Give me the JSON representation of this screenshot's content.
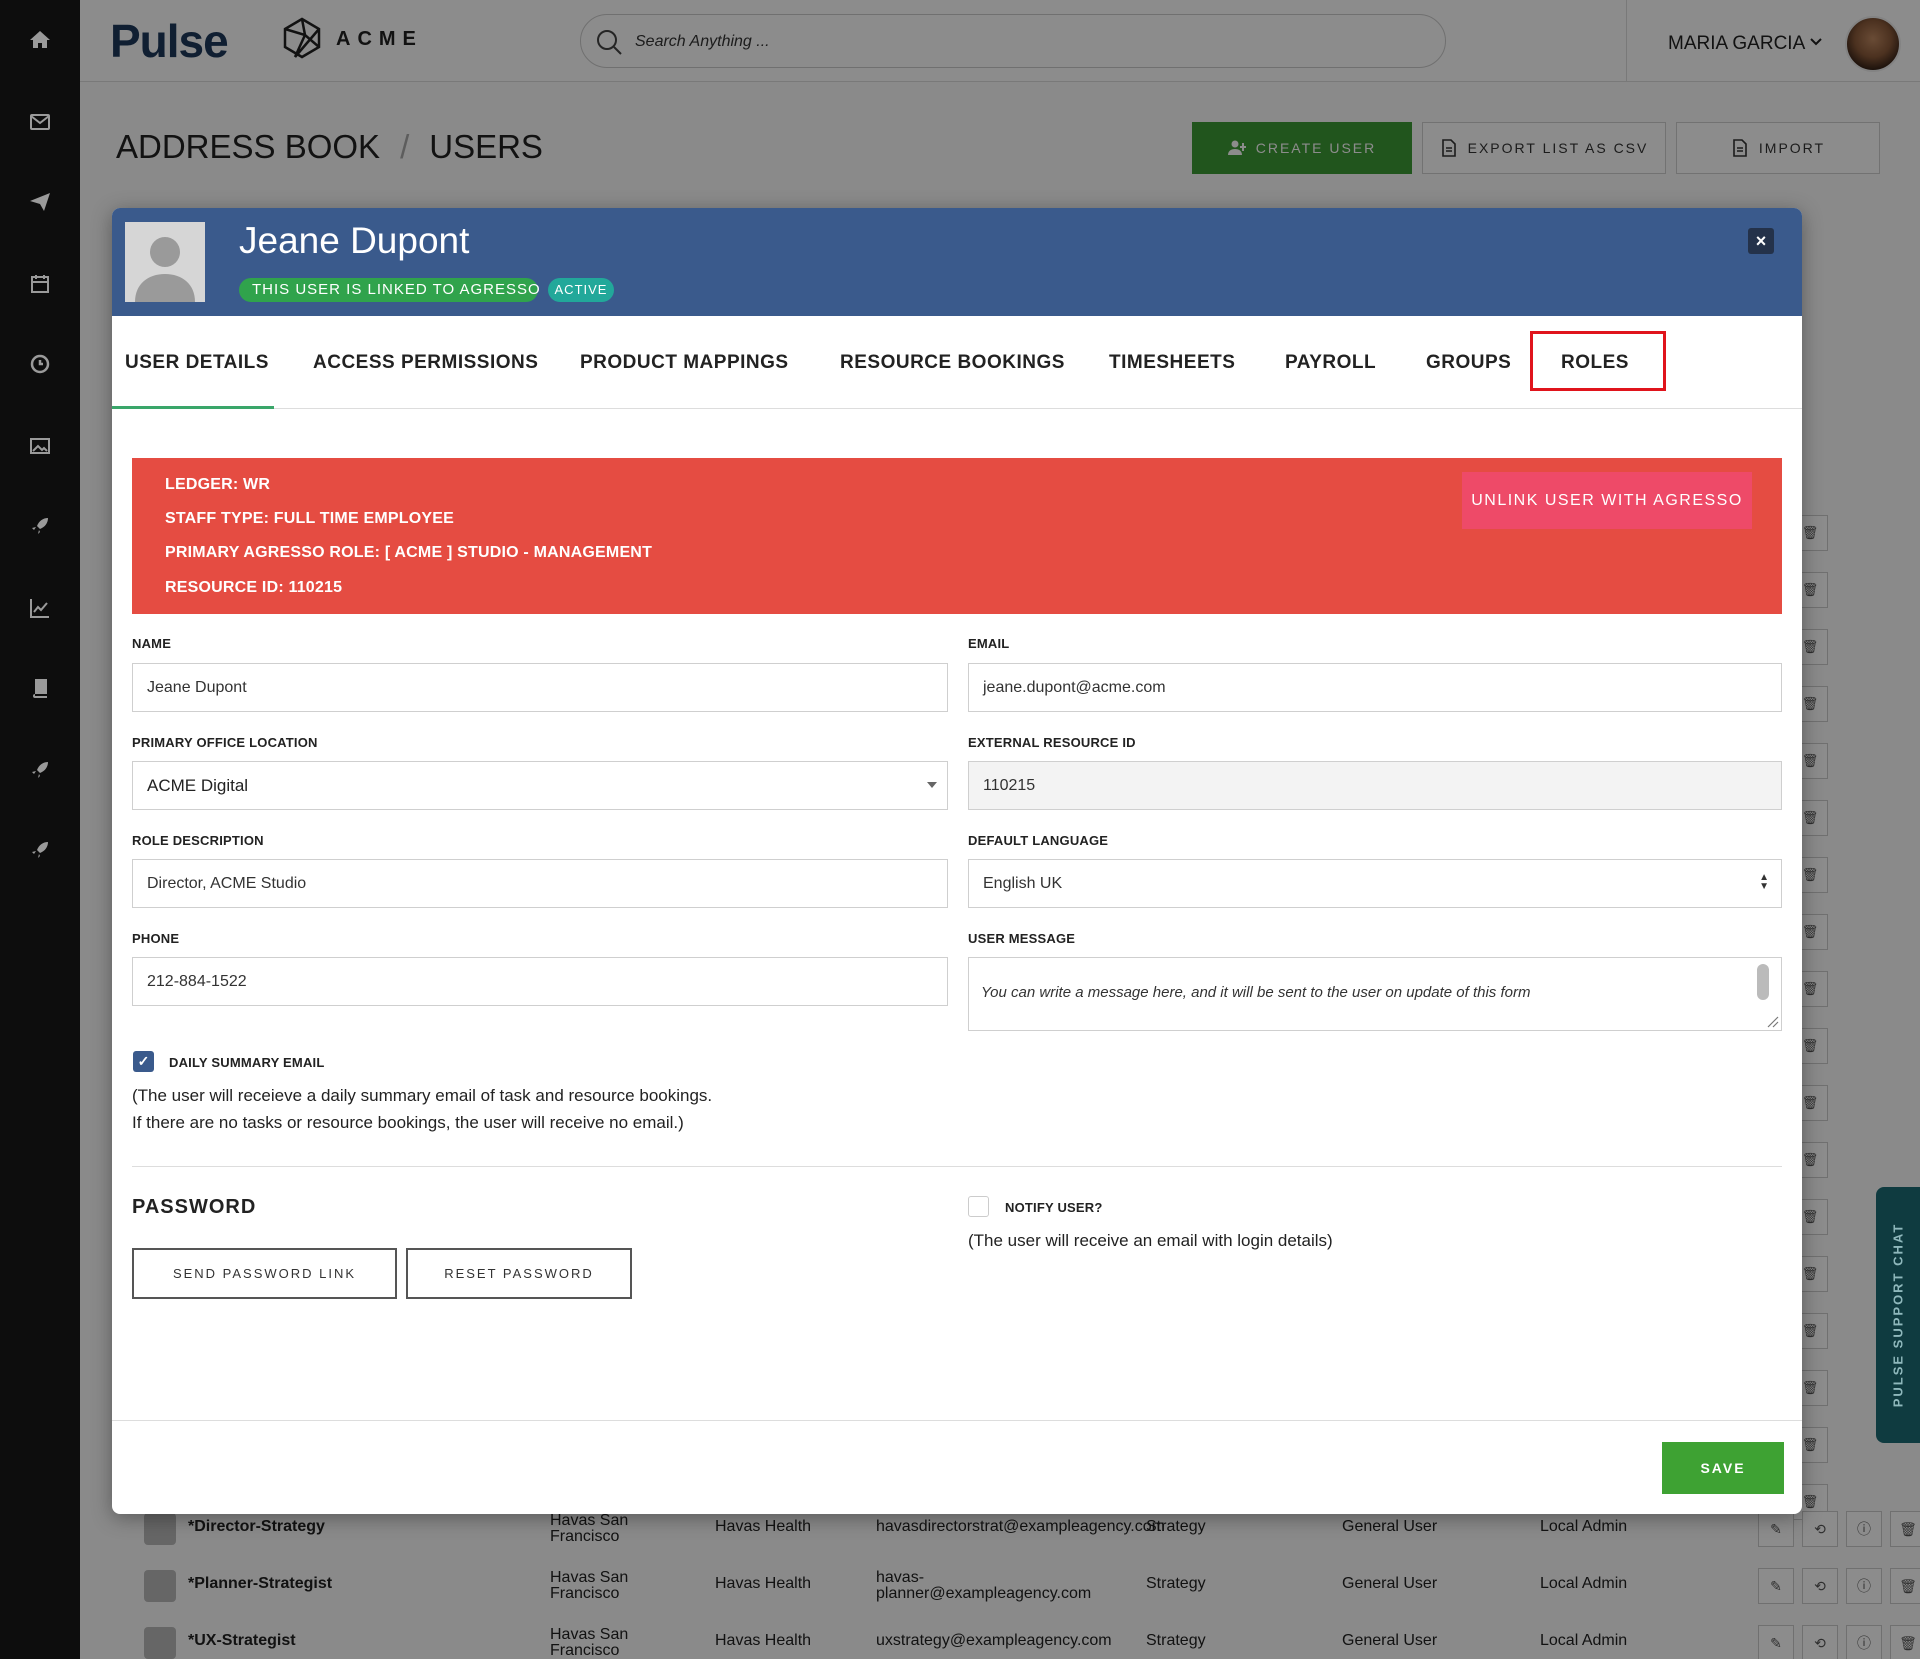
{
  "topbar": {
    "brand": "Pulse",
    "company": "ACME",
    "search_placeholder": "Search Anything ...",
    "user_name": "MARIA GARCIA"
  },
  "page": {
    "title_part1": "ADDRESS BOOK",
    "separator": "/",
    "title_part2": "USERS",
    "create_user": "CREATE USER",
    "export_csv": "EXPORT LIST AS CSV",
    "import": "IMPORT"
  },
  "background_rows": [
    {
      "name": "*Director-Strategy",
      "office_1": "Havas San",
      "office_2": "Francisco",
      "agency": "Havas Health",
      "email": "havasdirectorstrat@exampleagency.com",
      "dept": "Strategy",
      "role": "General User",
      "admin": "Local Admin"
    },
    {
      "name": "*Planner-Strategist",
      "office_1": "Havas San",
      "office_2": "Francisco",
      "agency": "Havas Health",
      "email_1": "havas-",
      "email_2": "planner@exampleagency.com",
      "dept": "Strategy",
      "role": "General User",
      "admin": "Local Admin"
    },
    {
      "name": "*UX-Strategist",
      "office_1": "Havas San",
      "office_2": "Francisco",
      "agency": "Havas Health",
      "email": "uxstrategy@exampleagency.com",
      "dept": "Strategy",
      "role": "General User",
      "admin": "Local Admin"
    }
  ],
  "support_chat": "PULSE SUPPORT CHAT",
  "modal": {
    "user_name": "Jeane Dupont",
    "badge_linked": "THIS USER IS LINKED TO AGRESSO",
    "badge_active": "ACTIVE",
    "close": "×",
    "tabs": [
      "USER DETAILS",
      "ACCESS PERMISSIONS",
      "PRODUCT MAPPINGS",
      "RESOURCE BOOKINGS",
      "TIMESHEETS",
      "PAYROLL",
      "GROUPS",
      "ROLES"
    ],
    "agresso": {
      "ledger": "LEDGER: WR",
      "staff_type": "STAFF TYPE: FULL TIME EMPLOYEE",
      "primary_role": "PRIMARY AGRESSO ROLE: [ ACME ] STUDIO - MANAGEMENT",
      "resource_id": "RESOURCE ID: 110215",
      "unlink_button": "UNLINK USER WITH AGRESSO"
    },
    "fields": {
      "name_label": "NAME",
      "name_value": "Jeane Dupont",
      "email_label": "EMAIL",
      "email_value": "jeane.dupont@acme.com",
      "office_label": "PRIMARY OFFICE LOCATION",
      "office_value": "ACME Digital",
      "ext_id_label": "EXTERNAL RESOURCE ID",
      "ext_id_value": "110215",
      "role_desc_label": "ROLE DESCRIPTION",
      "role_desc_value": "Director, ACME Studio",
      "language_label": "DEFAULT LANGUAGE",
      "language_value": "English UK",
      "phone_label": "PHONE",
      "phone_value": "212-884-1522",
      "message_label": "USER MESSAGE",
      "message_placeholder": "You can write a message here, and it will be sent to the user on update of this form"
    },
    "daily_summary": {
      "label": "DAILY SUMMARY EMAIL",
      "checked": true,
      "note_1": "(The user will receieve a daily summary email of task and resource bookings.",
      "note_2": "If there are no tasks or resource bookings, the user will receive no email.)"
    },
    "password": {
      "title": "PASSWORD",
      "send_link": "SEND PASSWORD LINK",
      "reset": "RESET PASSWORD",
      "notify_label": "NOTIFY USER?",
      "notify_checked": false,
      "notify_note": "(The user will receive an email with login details)"
    },
    "save": "SAVE"
  },
  "colors": {
    "modal_header": "#3a5a8c",
    "agresso_banner": "#e54c42",
    "save_green": "#3ea233",
    "highlight_red": "#e0141c"
  }
}
